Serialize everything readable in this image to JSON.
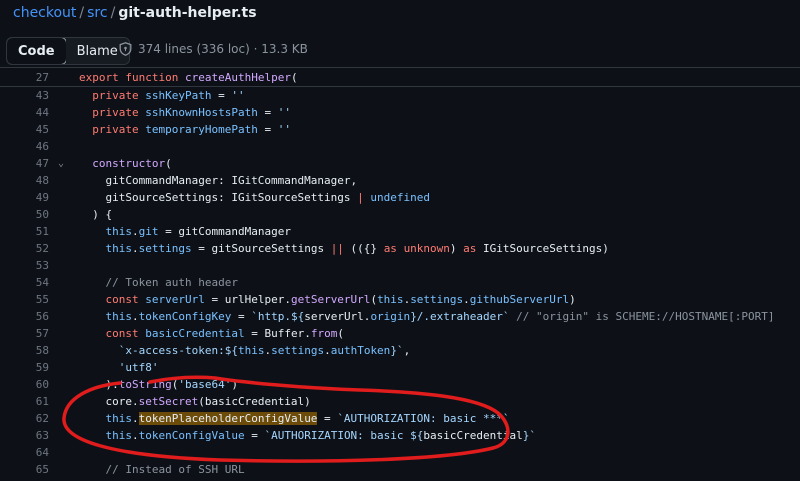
{
  "breadcrumb": {
    "repo": "checkout",
    "sep1": "/",
    "folder": "src",
    "sep2": "/",
    "file": "git-auth-helper.ts"
  },
  "toolbar": {
    "code_tab": "Code",
    "blame_tab": "Blame",
    "file_info": "374 lines (336 loc) · 13.3 KB"
  },
  "icons": {
    "shield": "shield-icon",
    "fold": "chevron-down-icon"
  },
  "colors": {
    "background": "#0d1117",
    "keyword": "#ff7b72",
    "function": "#d2a8ff",
    "property": "#79c0ff",
    "string": "#a5d6ff",
    "comment": "#8b949e",
    "highlight": "#9e6a03",
    "annotation": "#e01c1c"
  },
  "code": {
    "sticky": {
      "num": "27",
      "text": "export function createAuthHelper("
    },
    "lines": [
      {
        "num": "43",
        "text": "  private sshKeyPath = ''"
      },
      {
        "num": "44",
        "text": "  private sshKnownHostsPath = ''"
      },
      {
        "num": "45",
        "text": "  private temporaryHomePath = ''"
      },
      {
        "num": "46",
        "text": ""
      },
      {
        "num": "47",
        "text": "  constructor("
      },
      {
        "num": "48",
        "text": "    gitCommandManager: IGitCommandManager,"
      },
      {
        "num": "49",
        "text": "    gitSourceSettings: IGitSourceSettings | undefined"
      },
      {
        "num": "50",
        "text": "  ) {"
      },
      {
        "num": "51",
        "text": "    this.git = gitCommandManager"
      },
      {
        "num": "52",
        "text": "    this.settings = gitSourceSettings || (({} as unknown) as IGitSourceSettings)"
      },
      {
        "num": "53",
        "text": ""
      },
      {
        "num": "54",
        "text": "    // Token auth header"
      },
      {
        "num": "55",
        "text": "    const serverUrl = urlHelper.getServerUrl(this.settings.githubServerUrl)"
      },
      {
        "num": "56",
        "text": "    this.tokenConfigKey = `http.${serverUrl.origin}/.extraheader` // \"origin\" is SCHEME://HOSTNAME[:PORT]"
      },
      {
        "num": "57",
        "text": "    const basicCredential = Buffer.from("
      },
      {
        "num": "58",
        "text": "      `x-access-token:${this.settings.authToken}`,"
      },
      {
        "num": "59",
        "text": "      'utf8'"
      },
      {
        "num": "60",
        "text": "    ).toString('base64')"
      },
      {
        "num": "61",
        "text": "    core.setSecret(basicCredential)"
      },
      {
        "num": "62",
        "text": "    this.tokenPlaceholderConfigValue = `AUTHORIZATION: basic ***`"
      },
      {
        "num": "63",
        "text": "    this.tokenConfigValue = `AUTHORIZATION: basic ${basicCredential}`"
      },
      {
        "num": "64",
        "text": ""
      },
      {
        "num": "65",
        "text": "    // Instead of SSH URL"
      }
    ]
  }
}
